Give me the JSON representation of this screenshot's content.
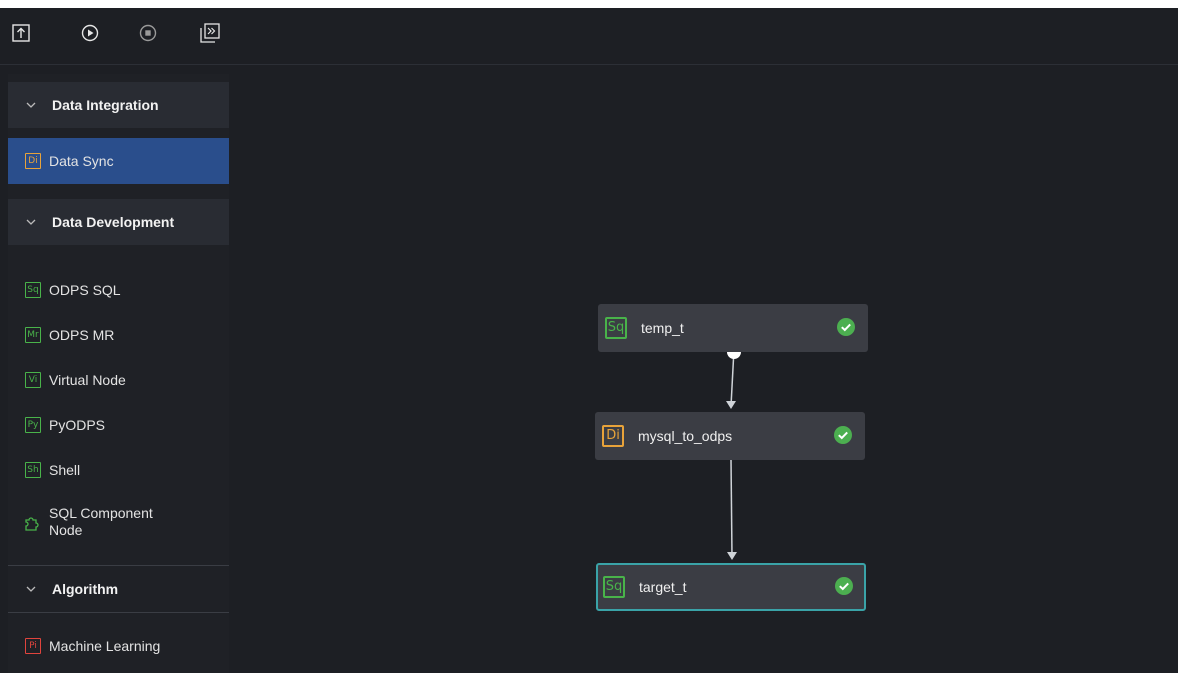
{
  "toolbar": {
    "buttons": [
      {
        "name": "submit-icon"
      },
      {
        "name": "run-icon"
      },
      {
        "name": "stop-icon"
      },
      {
        "name": "run-from-node-icon"
      }
    ]
  },
  "sidebar": {
    "groups": [
      {
        "title": "Data Integration",
        "items": [
          {
            "badge": "Di",
            "label": "Data Sync",
            "color": "#e8a33a",
            "selected": true
          }
        ]
      },
      {
        "title": "Data Development",
        "items": [
          {
            "badge": "Sq",
            "label": "ODPS SQL",
            "color": "#49b34a"
          },
          {
            "badge": "Mr",
            "label": "ODPS MR",
            "color": "#49b34a"
          },
          {
            "badge": "Vi",
            "label": "Virtual Node",
            "color": "#49b34a"
          },
          {
            "badge": "Py",
            "label": "PyODPS",
            "color": "#49b34a"
          },
          {
            "badge": "Sh",
            "label": "Shell",
            "color": "#49b34a"
          },
          {
            "icon": "puzzle-icon",
            "label": "SQL Component Node",
            "color": "#49b34a"
          }
        ]
      },
      {
        "title": "Algorithm",
        "items": [
          {
            "badge": "Pi",
            "label": "Machine Learning",
            "color": "#e0443d"
          }
        ]
      }
    ]
  },
  "canvas": {
    "nodes": [
      {
        "badge": "Sq",
        "label": "temp_t",
        "color": "#49b34a",
        "status": "success"
      },
      {
        "badge": "Di",
        "label": "mysql_to_odps",
        "color": "#e8a33a",
        "status": "success"
      },
      {
        "badge": "Sq",
        "label": "target_t",
        "color": "#49b34a",
        "status": "success",
        "selected": true
      }
    ]
  }
}
